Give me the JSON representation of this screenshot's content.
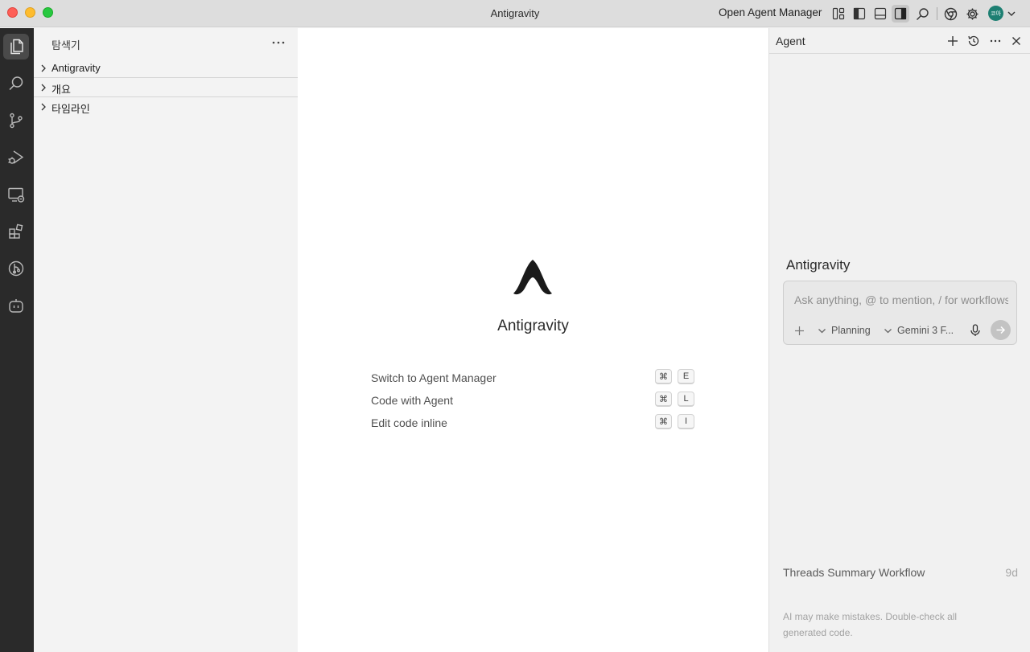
{
  "window": {
    "title": "Antigravity"
  },
  "titlebar": {
    "open_agent_manager": "Open Agent Manager",
    "avatar_initials": "코아",
    "icons": [
      "layout-icon",
      "toggle-primary-sidebar-icon",
      "toggle-panel-icon",
      "toggle-secondary-sidebar-icon",
      "search-icon",
      "chrome-icon",
      "gear-icon",
      "chevron-down-icon"
    ]
  },
  "activitybar": {
    "items": [
      "explorer-icon",
      "search-icon",
      "source-control-icon",
      "run-debug-icon",
      "remote-explorer-icon",
      "extensions-icon",
      "git-graph-icon",
      "agent-bot-icon"
    ]
  },
  "sidebar": {
    "title": "탐색기",
    "sections": [
      {
        "label": "Antigravity"
      },
      {
        "label": "개요"
      },
      {
        "label": "타임라인"
      }
    ]
  },
  "editor": {
    "welcome_title": "Antigravity",
    "shortcuts": [
      {
        "label": "Switch to Agent Manager",
        "key1": "⌘",
        "key2": "E"
      },
      {
        "label": "Code with Agent",
        "key1": "⌘",
        "key2": "L"
      },
      {
        "label": "Edit code inline",
        "key1": "⌘",
        "key2": "I"
      }
    ]
  },
  "agent_panel": {
    "title": "Agent",
    "heading": "Antigravity",
    "input_placeholder": "Ask anything, @ to mention, / for workflows",
    "mode_label": "Planning",
    "model_label": "Gemini 3 F...",
    "thread": {
      "name": "Threads Summary Workflow",
      "age": "9d"
    },
    "disclaimer": "AI may make mistakes. Double-check all generated code."
  },
  "colors": {
    "activitybar_bg": "#2a2a2a",
    "editor_bg": "#ffffff",
    "sidebar_bg": "#f3f3f3",
    "avatar_bg": "#1d7f72"
  }
}
